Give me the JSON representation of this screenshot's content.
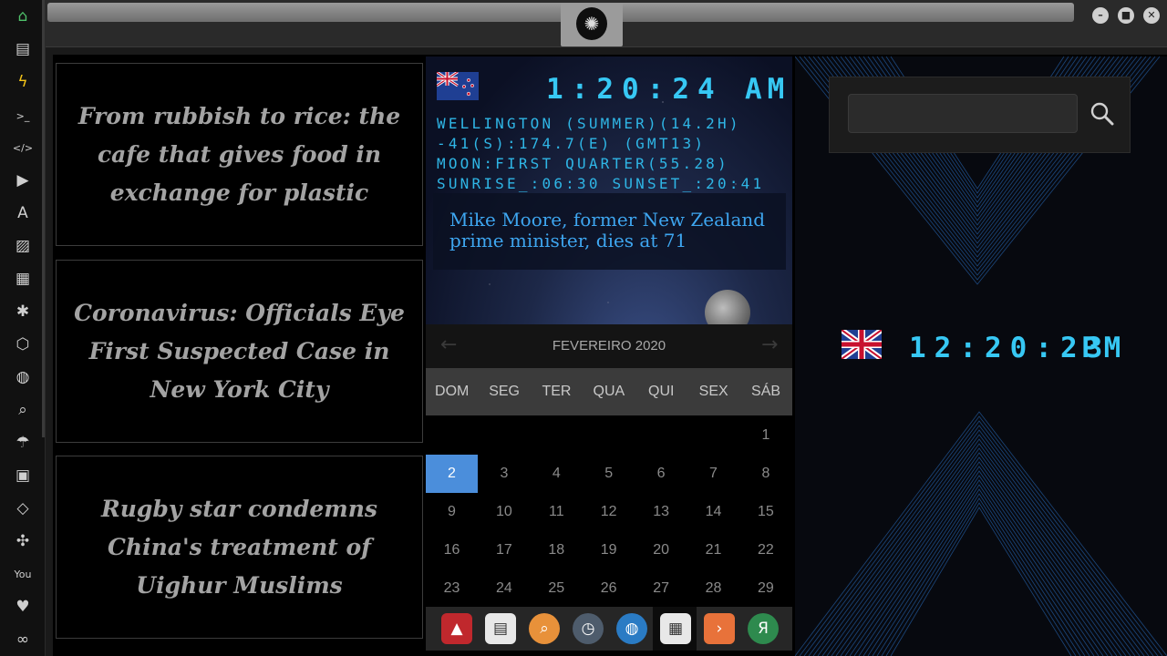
{
  "sidebar": {
    "items": [
      {
        "name": "home-icon",
        "glyph": "⌂"
      },
      {
        "name": "document-icon",
        "glyph": "▤"
      },
      {
        "name": "bolt-icon",
        "glyph": "ϟ"
      },
      {
        "name": "terminal-icon",
        "glyph": ">_"
      },
      {
        "name": "code-icon",
        "glyph": "</>"
      },
      {
        "name": "play-icon",
        "glyph": "▶"
      },
      {
        "name": "translate-icon",
        "glyph": "A"
      },
      {
        "name": "image-icon",
        "glyph": "▨"
      },
      {
        "name": "newspaper-icon",
        "glyph": "▦"
      },
      {
        "name": "aperture-icon",
        "glyph": "✱"
      },
      {
        "name": "hexagon-icon",
        "glyph": "⬡"
      },
      {
        "name": "globe-icon",
        "glyph": "◍"
      },
      {
        "name": "search-icon",
        "glyph": "⌕"
      },
      {
        "name": "umbrella-icon",
        "glyph": "☂"
      },
      {
        "name": "contacts-icon",
        "glyph": "▣"
      },
      {
        "name": "tag-icon",
        "glyph": "◇"
      },
      {
        "name": "expand-icon",
        "glyph": "✣"
      },
      {
        "name": "youtube-icon",
        "glyph": "You"
      },
      {
        "name": "heart-icon",
        "glyph": "♥"
      },
      {
        "name": "infinity-icon",
        "glyph": "∞"
      }
    ]
  },
  "news": [
    {
      "headline": "From rubbish to rice: the cafe that gives food in exchange for plastic"
    },
    {
      "headline": "Coronavirus: Officials Eye First Suspected Case in New York City"
    },
    {
      "headline": "Rugby star condemns China's treatment of Uighur Muslims"
    }
  ],
  "nz_clock": {
    "time": "1:20:24",
    "ampm": "AM",
    "lines": [
      "WELLINGTON (SUMMER)(14.2H)",
      "-41(S):174.7(E) (GMT13)",
      "MOON:FIRST QUARTER(55.28)",
      "SUNRISE_:06:30 SUNSET_:20:41"
    ],
    "headline": "Mike Moore, former New Zealand prime minister, dies at 71"
  },
  "calendar": {
    "title": "FEVEREIRO 2020",
    "prev": "←",
    "next": "→",
    "weekdays": [
      "DOM",
      "SEG",
      "TER",
      "QUA",
      "QUI",
      "SEX",
      "SÁB"
    ],
    "first_weekday_index": 6,
    "days_shown": 29,
    "selected_day": 2
  },
  "dock": {
    "apps": [
      {
        "name": "launcher-app",
        "glyph": "▲",
        "color": "#c0282d"
      },
      {
        "name": "newspaper-app",
        "glyph": "▤",
        "color": "#e8e8e8"
      },
      {
        "name": "search-app",
        "glyph": "⌕",
        "color": "#e8913a"
      },
      {
        "name": "clock-app",
        "glyph": "◷",
        "color": "#4e5c6c"
      },
      {
        "name": "globe-app",
        "glyph": "◍",
        "color": "#2a7bc4"
      },
      {
        "name": "calendar-app",
        "glyph": "▦",
        "color": "#e8e8e8"
      },
      {
        "name": "play-app",
        "glyph": "›",
        "color": "#e8723a"
      },
      {
        "name": "yandex-app",
        "glyph": "Я",
        "color": "#2e8a4e"
      }
    ]
  },
  "uk_clock": {
    "time": "12:20:23",
    "ampm": "PM"
  },
  "search": {
    "placeholder": ""
  }
}
